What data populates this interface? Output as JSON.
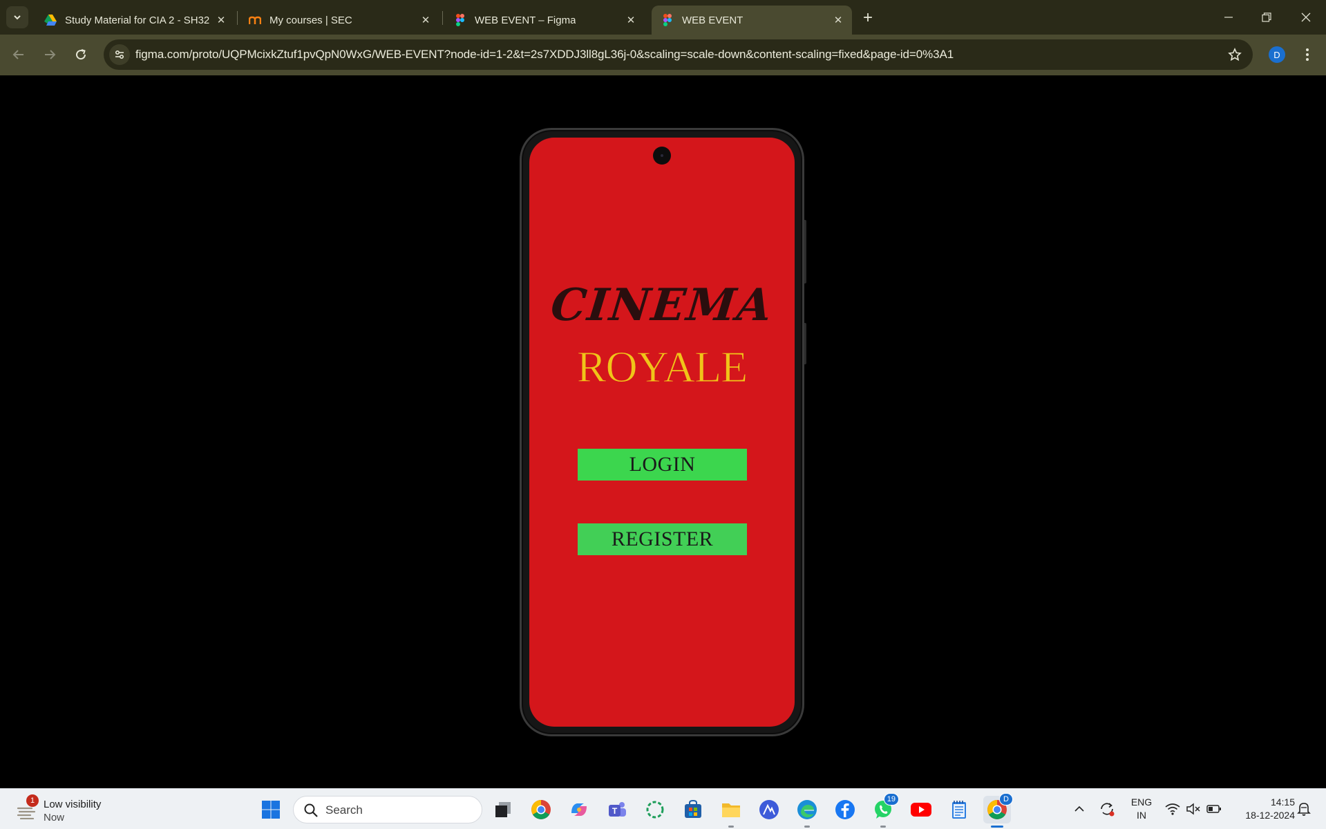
{
  "browser": {
    "tabs": [
      {
        "title": "Study Material for CIA 2 - SH32",
        "icon": "google-drive-icon",
        "active": false
      },
      {
        "title": "My courses | SEC",
        "icon": "moodle-icon",
        "active": false
      },
      {
        "title": "WEB EVENT – Figma",
        "icon": "figma-icon",
        "active": false
      },
      {
        "title": "WEB EVENT",
        "icon": "figma-icon",
        "active": true
      }
    ],
    "url": "figma.com/proto/UQPMcixkZtuf1pvQpN0WxG/WEB-EVENT?node-id=1-2&t=2s7XDDJ3ll8gL36j-0&scaling=scale-down&content-scaling=fixed&page-id=0%3A1",
    "profile_initial": "D"
  },
  "app": {
    "brand_line1": "CINEMA",
    "brand_line2": "ROYALE",
    "login_label": "LOGIN",
    "register_label": "REGISTER",
    "colors": {
      "screen_bg": "#d4161b",
      "brand_dark": "#2a0e0e",
      "brand_gold": "#f0c419",
      "button_green": "#3cd64e"
    }
  },
  "taskbar": {
    "weather": {
      "badge": "1",
      "line1": "Low visibility",
      "line2": "Now"
    },
    "search_placeholder": "Search",
    "whatsapp_badge": "19",
    "chrome_badge": "D",
    "lang_line1": "ENG",
    "lang_line2": "IN",
    "time": "14:15",
    "date": "18-12-2024"
  }
}
